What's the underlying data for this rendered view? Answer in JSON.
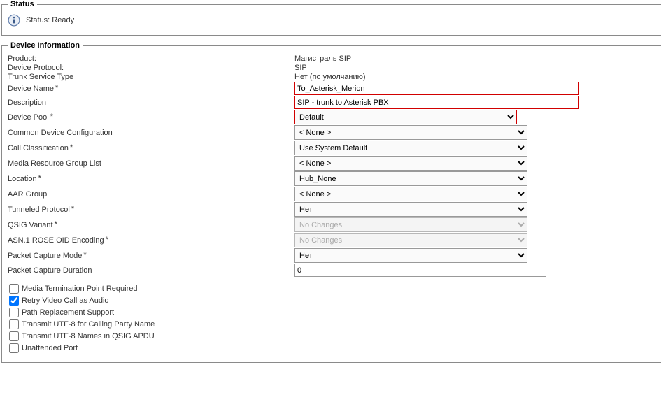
{
  "status": {
    "legend": "Status",
    "text": "Status: Ready"
  },
  "device": {
    "legend": "Device Information",
    "labels": {
      "product": "Product:",
      "protocol": "Device Protocol:",
      "trunkServiceType": "Trunk Service Type",
      "deviceName": "Device Name",
      "description": "Description",
      "devicePool": "Device Pool",
      "commonDeviceConfig": "Common Device Configuration",
      "callClassification": "Call Classification",
      "mediaResourceGroup": "Media Resource Group List",
      "location": "Location",
      "aarGroup": "AAR Group",
      "tunneledProtocol": "Tunneled Protocol",
      "qsigVariant": "QSIG Variant",
      "asn1Rose": "ASN.1 ROSE OID Encoding",
      "packetCaptureMode": "Packet Capture Mode",
      "packetCaptureDuration": "Packet Capture Duration"
    },
    "values": {
      "product": "Магистраль SIP",
      "protocol": "SIP",
      "trunkServiceType": "Нет (по умолчанию)",
      "deviceName": "To_Asterisk_Merion",
      "description": "SIP - trunk to Asterisk PBX",
      "devicePool": "Default",
      "commonDeviceConfig": "< None >",
      "callClassification": "Use System Default",
      "mediaResourceGroup": "< None >",
      "location": "Hub_None",
      "aarGroup": "< None >",
      "tunneledProtocol": "Нет",
      "qsigVariant": "No Changes",
      "asn1Rose": "No Changes",
      "packetCaptureMode": "Нет",
      "packetCaptureDuration": "0"
    },
    "checkboxes": {
      "mediaTermination": {
        "label": "Media Termination Point Required",
        "checked": false
      },
      "retryVideo": {
        "label": "Retry Video Call as Audio",
        "checked": true
      },
      "pathReplacement": {
        "label": "Path Replacement Support",
        "checked": false
      },
      "transmitUtf8Calling": {
        "label": "Transmit UTF-8 for Calling Party Name",
        "checked": false
      },
      "transmitUtf8Qsig": {
        "label": "Transmit UTF-8 Names in QSIG APDU",
        "checked": false
      },
      "unattendedPort": {
        "label": "Unattended Port",
        "checked": false
      }
    },
    "asterisk": "*"
  }
}
